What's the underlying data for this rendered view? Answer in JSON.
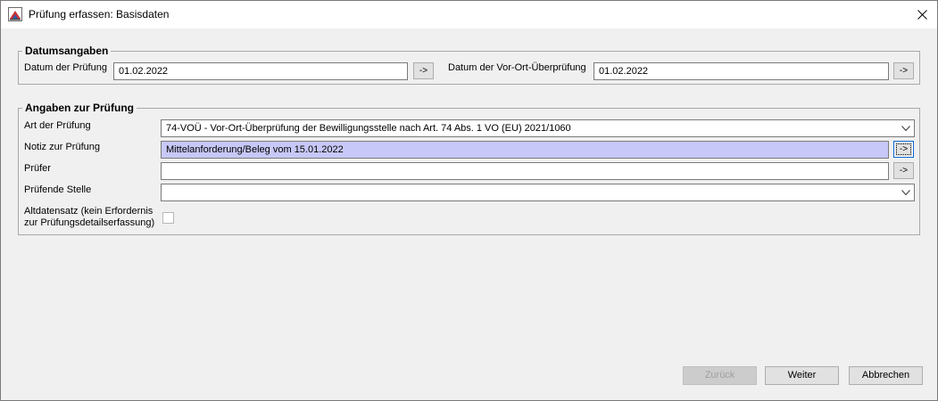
{
  "window": {
    "title": "Prüfung erfassen: Basisdaten"
  },
  "datumsangaben": {
    "legend": "Datumsangaben",
    "datum_label": "Datum der Prüfung",
    "datum_value": "01.02.2022",
    "datum_btn": "->",
    "vor_ort_label": "Datum der Vor-Ort-Überprüfung",
    "vor_ort_value": "01.02.2022",
    "vor_ort_btn": "->"
  },
  "angaben": {
    "legend": "Angaben zur Prüfung",
    "art_label": "Art der Prüfung",
    "art_value": "74-VOÜ - Vor-Ort-Überprüfung der Bewilligungsstelle nach Art. 74 Abs. 1 VO (EU) 2021/1060",
    "notiz_label": "Notiz zur Prüfung",
    "notiz_value": "Mittelanforderung/Beleg vom 15.01.2022",
    "notiz_btn": "->",
    "pruefer_label": "Prüfer",
    "pruefer_value": "",
    "pruefer_btn": "->",
    "stelle_label": "Prüfende Stelle",
    "stelle_value": "",
    "alt_label_line1": "Altdatensatz (kein Erfordernis",
    "alt_label_line2": "zur Prüfungsdetailserfassung)",
    "alt_checked": false
  },
  "buttons": {
    "zurueck": "Zurück",
    "weiter": "Weiter",
    "abbrechen": "Abbrechen"
  }
}
